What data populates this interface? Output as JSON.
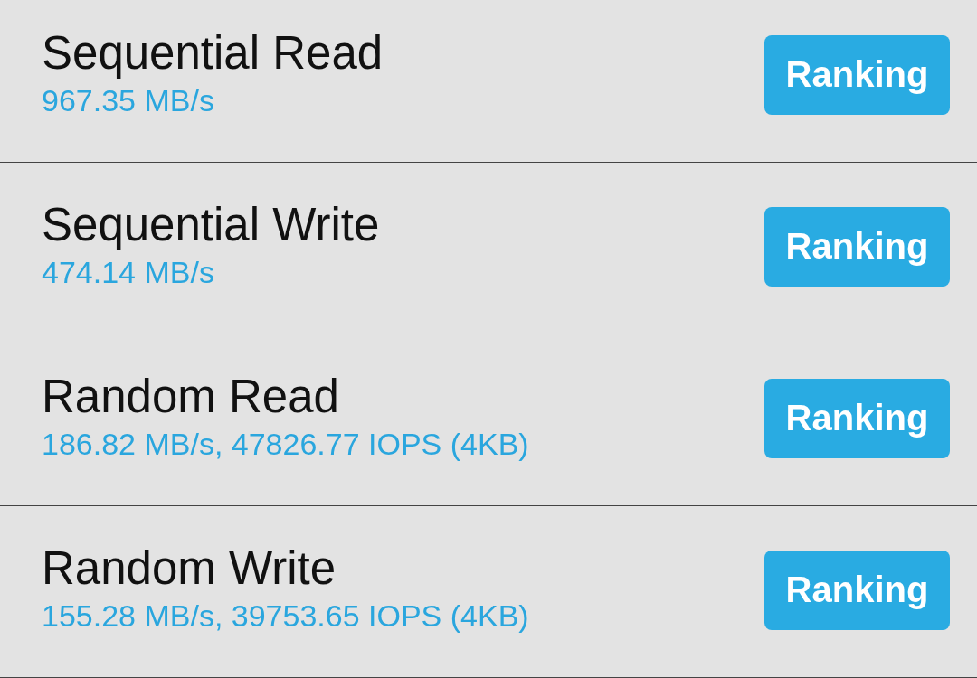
{
  "results": [
    {
      "title": "Sequential Read",
      "value": "967.35 MB/s",
      "button": "Ranking"
    },
    {
      "title": "Sequential Write",
      "value": "474.14 MB/s",
      "button": "Ranking"
    },
    {
      "title": "Random Read",
      "value": "186.82 MB/s, 47826.77 IOPS (4KB)",
      "button": "Ranking"
    },
    {
      "title": "Random Write",
      "value": "155.28 MB/s, 39753.65 IOPS (4KB)",
      "button": "Ranking"
    }
  ]
}
